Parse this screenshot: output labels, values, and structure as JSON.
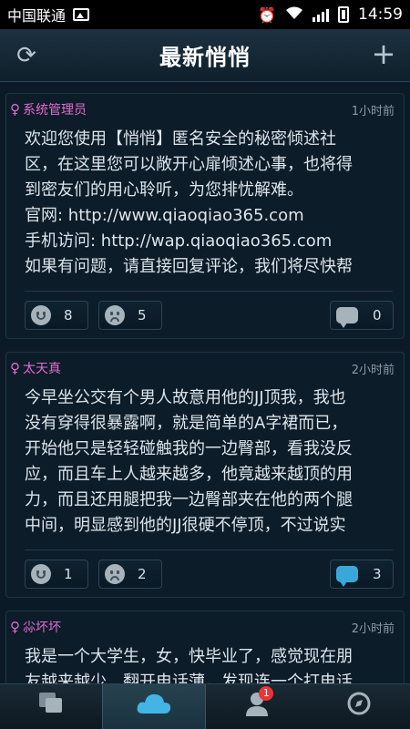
{
  "statusbar": {
    "carrier": "中国联通",
    "time": "14:59",
    "icons": [
      "image-icon",
      "alarm-icon",
      "wifi-icon",
      "signal-icon",
      "battery-icon"
    ]
  },
  "header": {
    "title": "最新悄悄",
    "left_icon": "refresh-icon",
    "right_icon": "plus-icon"
  },
  "posts": [
    {
      "author": "系统管理员",
      "time": "1小时前",
      "text": "欢迎您使用【悄悄】匿名安全的秘密倾述社\n区，在这里您可以敞开心扉倾述心事，也将得\n到密友们的用心聆听，为您排忧解难。\n官网: http://www.qiaoqiao365.com\n手机访问: http://wap.qiaoqiao365.com\n如果有问题，请直接回复评论，我们将尽快帮",
      "likes": "8",
      "dislikes": "5",
      "comments": "0"
    },
    {
      "author": "太天真",
      "time": "2小时前",
      "text": "今早坐公交有个男人故意用他的JJ顶我，我也\n没有穿得很暴露啊，就是简单的A字裙而已，\n开始他只是轻轻碰触我的一边臀部，看我没反\n应，而且车上人越来越多，他竟越来越顶的用\n力，而且还用腿把我一边臀部夹在他的两个腿\n中间，明显感到他的JJ很硬不停顶，不过说实",
      "likes": "1",
      "dislikes": "2",
      "comments": "3"
    },
    {
      "author": "尛坏坏",
      "time": "2小时前",
      "text": "我是一个大学生，女，快毕业了，感觉现在朋\n友越来越少，翻开电话薄，发现连一个打电话",
      "likes": "",
      "dislikes": "",
      "comments": ""
    }
  ],
  "bottom_nav": {
    "tabs": [
      {
        "icon": "chat-icon",
        "active": false
      },
      {
        "icon": "cloud-icon",
        "active": true
      },
      {
        "icon": "profile-icon",
        "active": false,
        "badge": "1"
      },
      {
        "icon": "compass-icon",
        "active": false
      }
    ]
  },
  "colors": {
    "background": "#0b1a26",
    "author": "#e26bd0",
    "accent": "#39a8d8"
  }
}
